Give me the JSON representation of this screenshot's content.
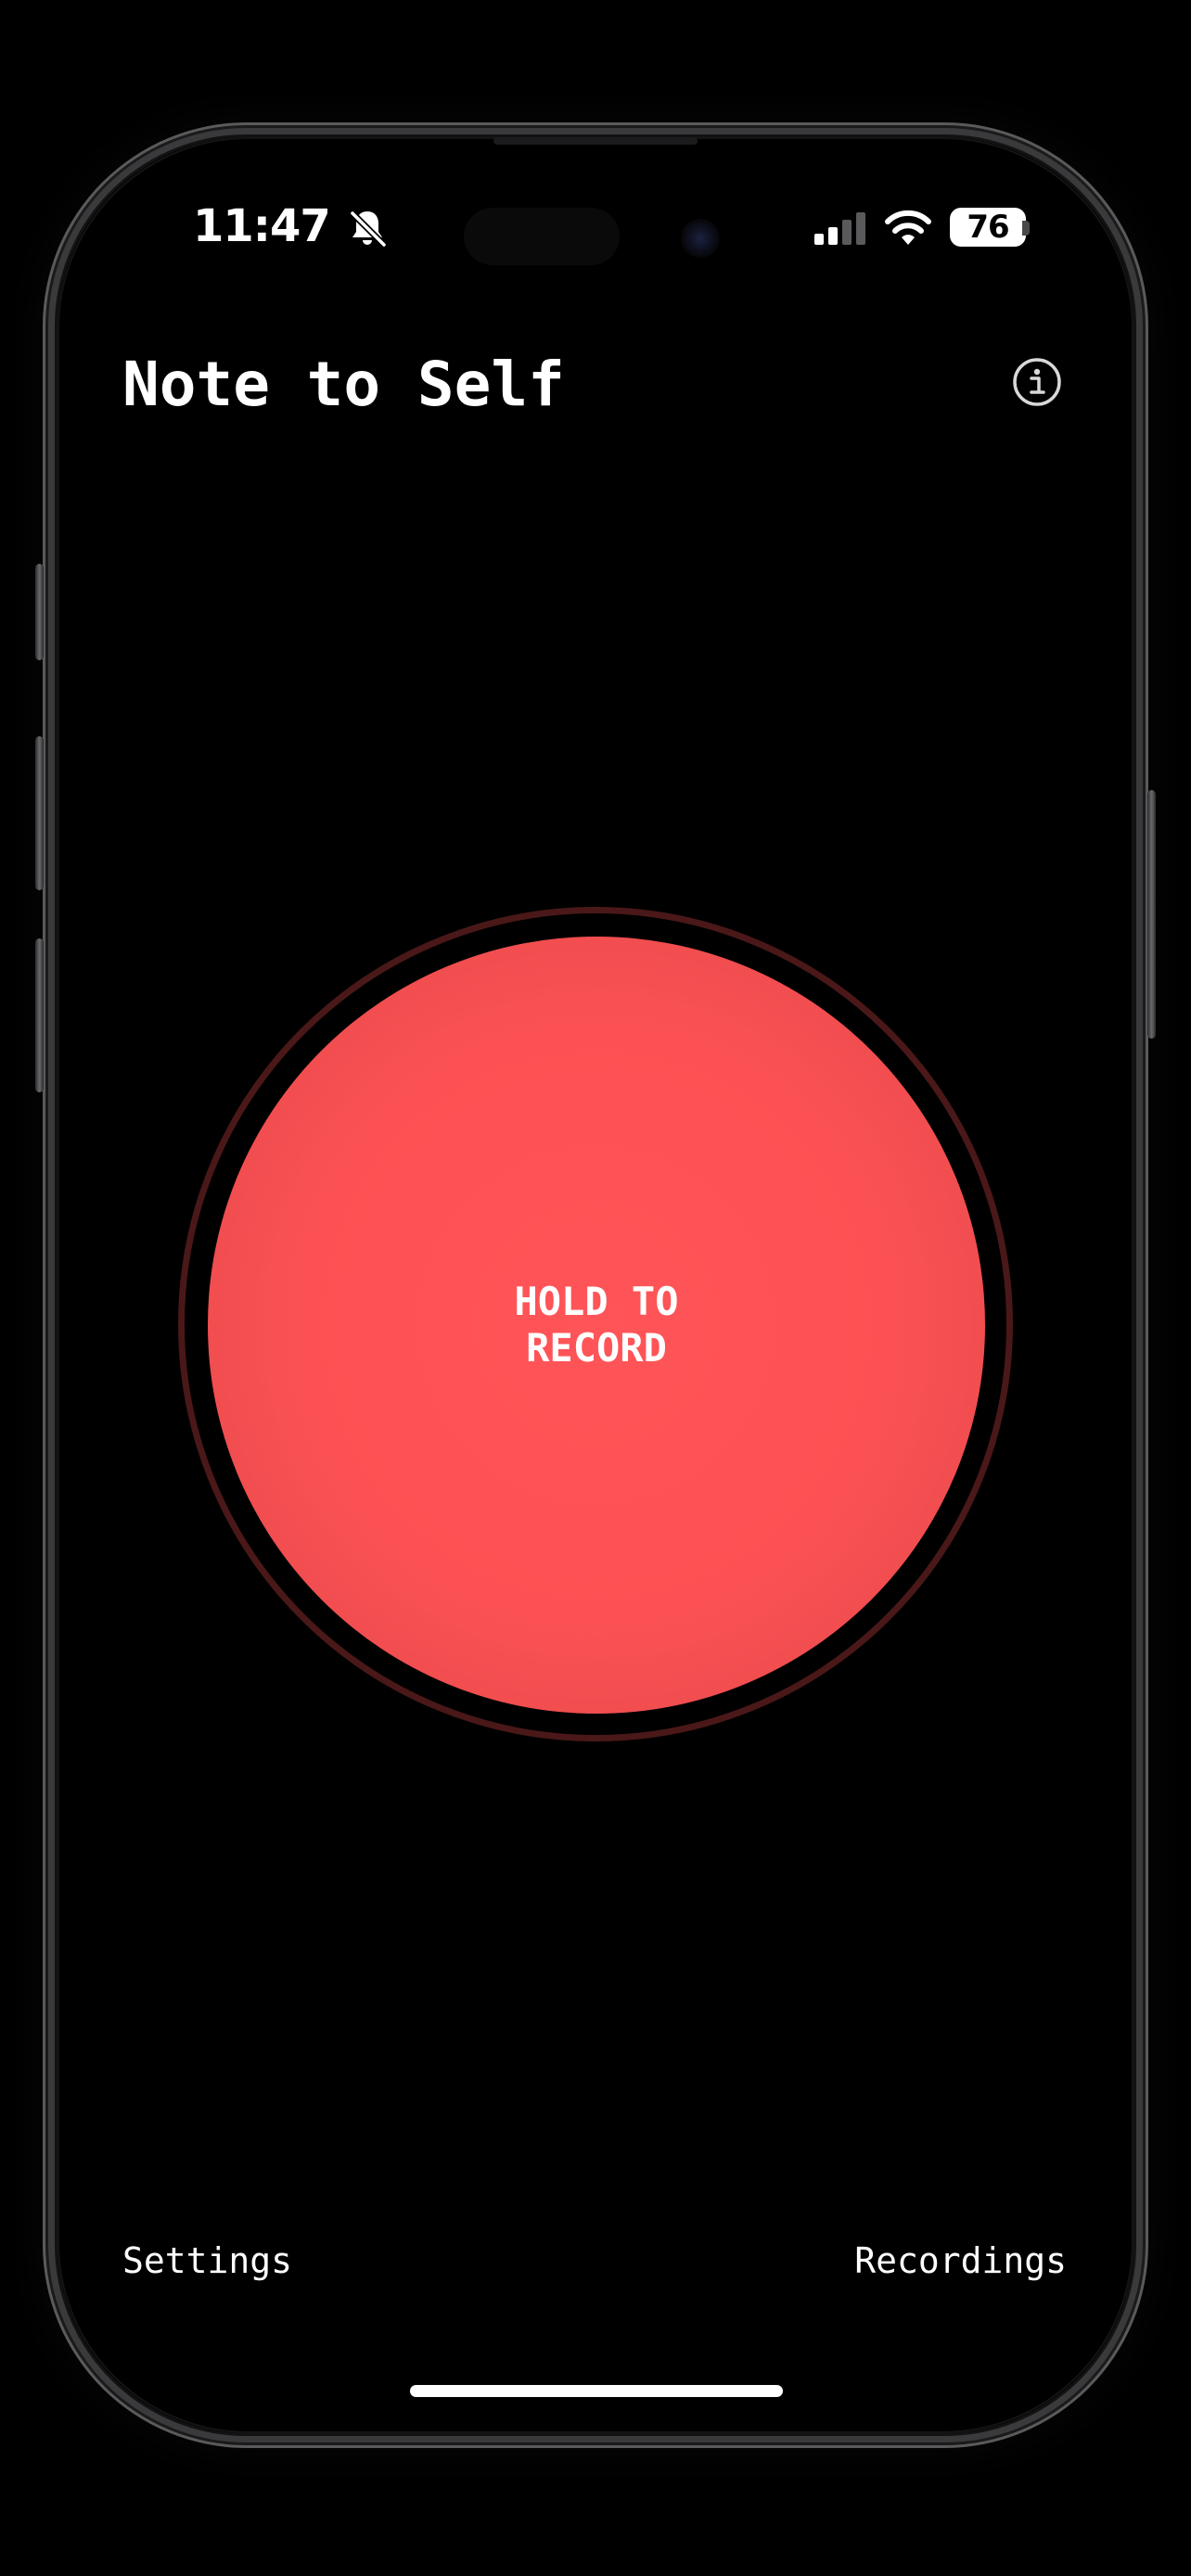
{
  "status_bar": {
    "time": "11:47",
    "battery": "76",
    "icons": [
      "bell-slash-icon",
      "cellular-signal-icon",
      "wifi-icon",
      "battery-icon"
    ]
  },
  "header": {
    "title": "Note to Self",
    "info_icon": "info-circle-icon"
  },
  "record": {
    "label": "HOLD TO\nRECORD",
    "colors": {
      "button": "#fb5154",
      "ring": "#4a1818"
    }
  },
  "footer": {
    "settings_label": "Settings",
    "recordings_label": "Recordings"
  },
  "colors": {
    "background": "#000000",
    "text": "#ffffff"
  }
}
